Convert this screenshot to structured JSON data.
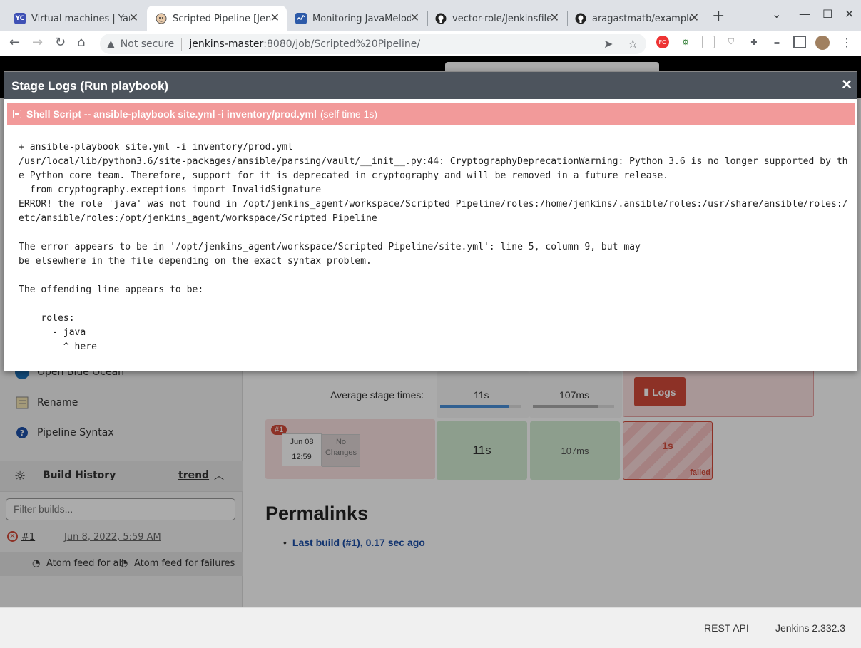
{
  "browser": {
    "tabs": [
      {
        "title": "Virtual machines | Yand",
        "favicon": "YC"
      },
      {
        "title": "Scripted Pipeline [Jenk",
        "favicon": "jenkins-icon"
      },
      {
        "title": "Monitoring JavaMelody",
        "favicon": "monitor-icon"
      },
      {
        "title": "vector-role/Jenkinsfile",
        "favicon": "github-icon"
      },
      {
        "title": "aragastmatb/example",
        "favicon": "github-icon"
      }
    ],
    "not_secure": "Not secure",
    "url_host": "jenkins-master",
    "url_path": ":8080/job/Scripted%20Pipeline/",
    "ext_fo": "FO"
  },
  "sidebar": {
    "open_blue_ocean": "Open Blue Ocean",
    "rename": "Rename",
    "pipeline_syntax": "Pipeline Syntax",
    "build_history": "Build History",
    "trend": "trend",
    "filter_placeholder": "Filter builds...",
    "build_number": "#1",
    "build_date": "Jun 8, 2022, 5:59 AM",
    "atom_all": "Atom feed for all",
    "atom_failures": "Atom feed for failures"
  },
  "stage_view": {
    "average_label": "Average stage times:",
    "avg_times": [
      "11s",
      "107ms"
    ],
    "avg_progress": [
      0.85,
      0.8
    ],
    "logs_button": "Logs",
    "build_badge": "#1",
    "build_month_day": "Jun 08",
    "build_time": "12:59",
    "no_changes": "No Changes",
    "cells": [
      "11s",
      "107ms",
      "1s"
    ],
    "failed": "failed"
  },
  "permalinks": {
    "title": "Permalinks",
    "last_build": "Last build (#1), 0.17 sec ago"
  },
  "footer": {
    "rest_api": "REST API",
    "version": "Jenkins 2.332.3"
  },
  "modal": {
    "title": "Stage Logs (Run playbook)",
    "step_title": "Shell Script -- ansible-playbook site.yml -i inventory/prod.yml",
    "step_time": "(self time 1s)",
    "log_text": "+ ansible-playbook site.yml -i inventory/prod.yml\n/usr/local/lib/python3.6/site-packages/ansible/parsing/vault/__init__.py:44: CryptographyDeprecationWarning: Python 3.6 is no longer supported by th\ne Python core team. Therefore, support for it is deprecated in cryptography and will be removed in a future release.\n  from cryptography.exceptions import InvalidSignature\nERROR! the role 'java' was not found in /opt/jenkins_agent/workspace/Scripted Pipeline/roles:/home/jenkins/.ansible/roles:/usr/share/ansible/roles:/\netc/ansible/roles:/opt/jenkins_agent/workspace/Scripted Pipeline\n\nThe error appears to be in '/opt/jenkins_agent/workspace/Scripted Pipeline/site.yml': line 5, column 9, but may\nbe elsewhere in the file depending on the exact syntax problem.\n\nThe offending line appears to be:\n\n    roles:\n      - java\n        ^ here"
  },
  "colors": {
    "modal_header": "#4d545d",
    "step_bar": "#f29a9a",
    "failed_red": "#d24939",
    "success_green": "#d2ecd2"
  }
}
